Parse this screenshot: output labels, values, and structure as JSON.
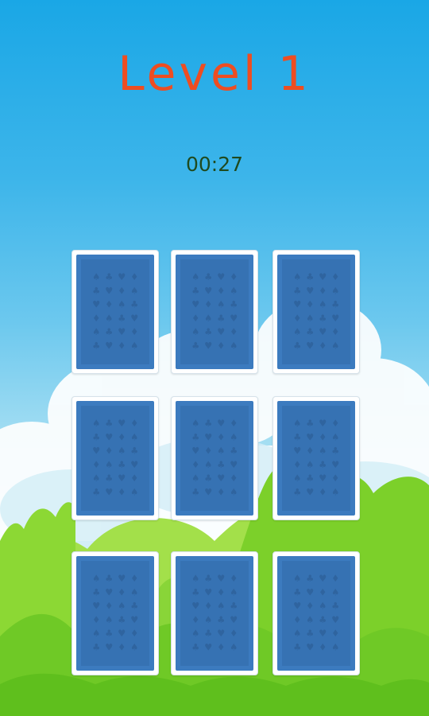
{
  "level": {
    "title": "Level 1"
  },
  "timer": {
    "value": "00:27"
  },
  "board": {
    "card_count": 9,
    "cards": [
      {
        "state": "face-down"
      },
      {
        "state": "face-down"
      },
      {
        "state": "face-down"
      },
      {
        "state": "face-down"
      },
      {
        "state": "face-down"
      },
      {
        "state": "face-down"
      },
      {
        "state": "face-down"
      },
      {
        "state": "face-down"
      },
      {
        "state": "face-down"
      }
    ]
  },
  "colors": {
    "title": "#ee4d21",
    "timer": "#1f4a1e",
    "card_back": "#3c7bbf",
    "card_back_inner": "#3672b3",
    "card_pattern": "#2f649f",
    "card_border": "#ffffff",
    "grass_light": "#8fdc3a",
    "grass_dark": "#66c420"
  },
  "icons": {
    "card_pattern": "card-suit-pattern-icon"
  }
}
